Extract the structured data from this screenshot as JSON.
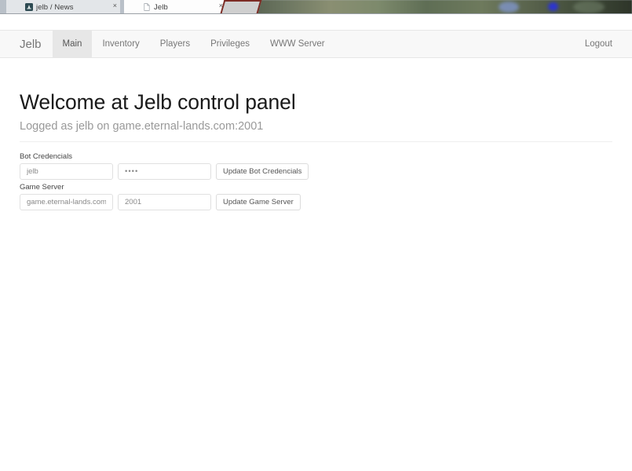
{
  "browser": {
    "tabs": [
      {
        "title": "jelb / News",
        "favicon": "gitlab-icon",
        "close_label": "×",
        "active": false
      },
      {
        "title": "Jelb",
        "favicon": "page-icon",
        "close_label": "×",
        "active": true
      }
    ],
    "leading_close_label": "×",
    "new_tab_label": ""
  },
  "navbar": {
    "brand": "Jelb",
    "items": [
      {
        "label": "Main",
        "active": true
      },
      {
        "label": "Inventory",
        "active": false
      },
      {
        "label": "Players",
        "active": false
      },
      {
        "label": "Privileges",
        "active": false
      },
      {
        "label": "WWW Server",
        "active": false
      }
    ],
    "logout_label": "Logout"
  },
  "header": {
    "title": "Welcome at Jelb control panel",
    "subtitle": "Logged as jelb on game.eternal-lands.com:2001"
  },
  "form": {
    "bot_credencials": {
      "label": "Bot Credencials",
      "username_value": "jelb",
      "username_placeholder": "jelb",
      "password_value": "••••",
      "password_placeholder": "",
      "button_label": "Update Bot Credencials"
    },
    "game_server": {
      "label": "Game Server",
      "host_value": "game.eternal-lands.com",
      "host_placeholder": "game.eternal-lands.com",
      "port_value": "2001",
      "port_placeholder": "2001",
      "button_label": "Update Game Server"
    }
  },
  "colors": {
    "navbar_bg": "#f8f8f8",
    "nav_active_bg": "#e7e7e7",
    "nav_text": "#777777",
    "title_text": "#1a1a1a",
    "subtitle_text": "#999999",
    "border": "#e7e7e7",
    "favicon_accent": "#2d4a52"
  }
}
